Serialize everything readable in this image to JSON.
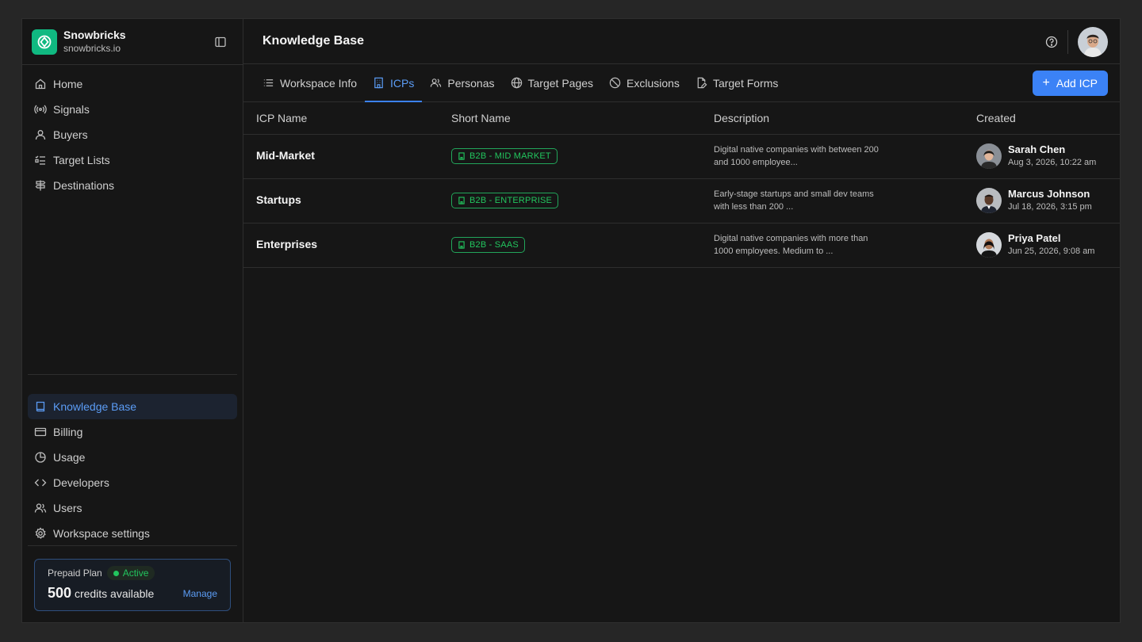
{
  "brand": {
    "name": "Snowbricks",
    "domain": "snowbricks.io"
  },
  "sidebar": {
    "top_items": [
      {
        "label": "Home",
        "icon": "home-icon"
      },
      {
        "label": "Signals",
        "icon": "signal-icon"
      },
      {
        "label": "Buyers",
        "icon": "user-icon"
      },
      {
        "label": "Target Lists",
        "icon": "list-check-icon"
      },
      {
        "label": "Destinations",
        "icon": "signpost-icon"
      }
    ],
    "bottom_items": [
      {
        "label": "Knowledge Base",
        "icon": "book-icon",
        "active": true
      },
      {
        "label": "Billing",
        "icon": "credit-card-icon"
      },
      {
        "label": "Usage",
        "icon": "pie-chart-icon"
      },
      {
        "label": "Developers",
        "icon": "code-icon"
      },
      {
        "label": "Users",
        "icon": "users-icon"
      },
      {
        "label": "Workspace settings",
        "icon": "gear-icon"
      }
    ],
    "plan": {
      "title": "Prepaid Plan",
      "status": "Active",
      "credits": "500",
      "credits_label": "credits available",
      "manage_label": "Manage"
    }
  },
  "header": {
    "title": "Knowledge Base"
  },
  "tabs": [
    {
      "label": "Workspace Info",
      "icon": "list-icon"
    },
    {
      "label": "ICPs",
      "icon": "building-icon",
      "active": true
    },
    {
      "label": "Personas",
      "icon": "users-icon"
    },
    {
      "label": "Target Pages",
      "icon": "globe-icon"
    },
    {
      "label": "Exclusions",
      "icon": "ban-icon"
    },
    {
      "label": "Target Forms",
      "icon": "file-edit-icon"
    }
  ],
  "add_button": {
    "label": "Add ICP"
  },
  "table": {
    "columns": [
      "ICP Name",
      "Short Name",
      "Description",
      "Created"
    ],
    "rows": [
      {
        "name": "Mid-Market",
        "short": "B2B - MID MARKET",
        "desc": "Digital native companies with between 200 and 1000 employee...",
        "creator": "Sarah Chen",
        "date": "Aug 3, 2026, 10:22 am"
      },
      {
        "name": "Startups",
        "short": "B2B - ENTERPRISE",
        "desc": "Early-stage startups and small dev teams with less than 200 ...",
        "creator": "Marcus Johnson",
        "date": "Jul 18, 2026, 3:15 pm"
      },
      {
        "name": "Enterprises",
        "short": "B2B - SAAS",
        "desc": "Digital native companies with more than 1000 employees. Medium to ...",
        "creator": "Priya Patel",
        "date": "Jun 25, 2026, 9:08 am"
      }
    ]
  },
  "colors": {
    "accent": "#3b82f6",
    "brand": "#10b981",
    "success": "#22c55e"
  }
}
